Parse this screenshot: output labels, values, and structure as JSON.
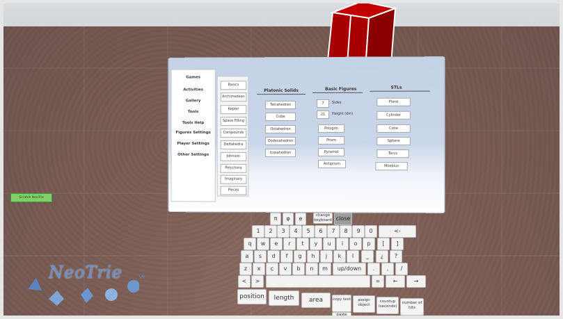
{
  "side_menu": {
    "items": [
      "Games",
      "Activities",
      "Gallery",
      "Tools",
      "Tools Help",
      "Figures Settings",
      "Player Settings",
      "Other Settings"
    ],
    "scratch_button": "Scratch NeoTrie"
  },
  "sub_menu": {
    "items": [
      "Basics",
      "Archimedean",
      "Kepler",
      "Space Filling",
      "Compounds",
      "Deltahedra",
      "Johnson",
      "Polychora",
      "Imaginary",
      "Pieces"
    ]
  },
  "platonic": {
    "header": "Platonic Solids",
    "items": [
      "Tetrahedron",
      "Cube",
      "Octahedron",
      "Dodecahedron",
      "Icosahedron"
    ]
  },
  "basic_figures": {
    "header": "Basic Figures",
    "sides_value": "7",
    "sides_label": "Sides",
    "height_value": "21",
    "height_label": "Height (dm)",
    "items": [
      "Polygon",
      "Prism",
      "Pyramid",
      "Antiprism"
    ]
  },
  "stls": {
    "header": "STLs",
    "items": [
      "Plane",
      "Cylinder",
      "Cone",
      "Sphere",
      "Torus",
      "Moebius"
    ]
  },
  "keyboard": {
    "top_row": [
      "π",
      "φ",
      "e"
    ],
    "change_keyboard": "change keyboard",
    "close": "close",
    "number_row": [
      "1",
      "2",
      "3",
      "4",
      "5",
      "6",
      "7",
      "8",
      "9",
      "0",
      "<-"
    ],
    "row_q": [
      "q",
      "w",
      "e",
      "r",
      "t",
      "y",
      "u",
      "i",
      "o",
      "p",
      "[",
      "]"
    ],
    "row_a": [
      "a",
      "s",
      "d",
      "f",
      "g",
      "h",
      "j",
      "k",
      "l",
      "_",
      "¿",
      "?"
    ],
    "row_z": [
      "z",
      "x",
      "c",
      "v",
      "b",
      "n",
      "m"
    ],
    "updown": "up/down",
    "row_z_tail": [
      ".",
      ",",
      "/"
    ],
    "lt": "<",
    "gt": ">",
    "eq": "=",
    "left_arrow": "←",
    "right_arrow": "→",
    "bottom_row": [
      "position",
      "length",
      "area"
    ],
    "copy_text": "copy text",
    "assign_object": "assign object",
    "countup": "countup (seconds)",
    "number_of_hits": "number of hits",
    "paste": "paste"
  },
  "logo": {
    "text": "NeoTrie",
    "suffix": "VR"
  },
  "colors": {
    "cube": "#b00000",
    "panel_top": "#c4d2e6",
    "logo": "#6b8fc4"
  }
}
